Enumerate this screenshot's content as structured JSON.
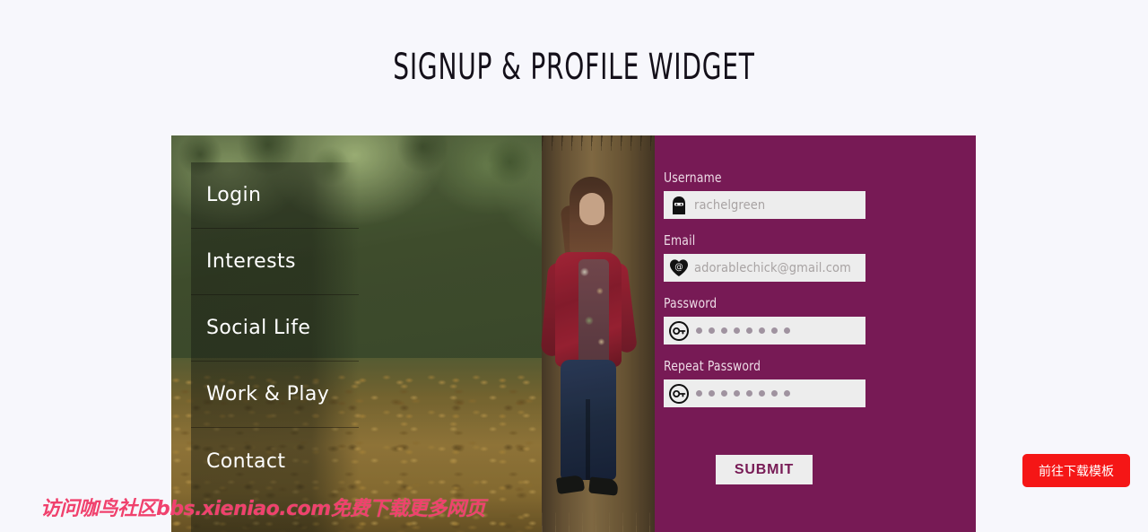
{
  "page": {
    "title": "SIGNUP & PROFILE WIDGET",
    "background_color": "#f7f7fc",
    "accent_color": "#771a55"
  },
  "menu": {
    "items": [
      {
        "label": "Login"
      },
      {
        "label": "Interests"
      },
      {
        "label": "Social Life"
      },
      {
        "label": "Work & Play"
      },
      {
        "label": "Contact"
      }
    ]
  },
  "form": {
    "fields": [
      {
        "label": "Username",
        "icon": "ninja-person-icon",
        "value": "rachelgreen",
        "placeholder": "rachelgreen",
        "type": "text"
      },
      {
        "label": "Email",
        "icon": "heart-at-icon",
        "value": "adorablechick@gmail.com",
        "placeholder": "adorablechick@gmail.com",
        "type": "email"
      },
      {
        "label": "Password",
        "icon": "key-circle-icon",
        "value": "••••••••",
        "placeholder": "",
        "type": "password",
        "dot_count": 8
      },
      {
        "label": "Repeat Password",
        "icon": "key-circle-icon",
        "value": "••••••••",
        "placeholder": "",
        "type": "password",
        "dot_count": 8
      }
    ],
    "submit_label": "SUBMIT"
  },
  "watermark": {
    "text": "访问咖鸟社区bbs.xieniao.com免费下载更多网页",
    "color": "#f0416d"
  },
  "download_button": {
    "label": "前往下载模板",
    "color": "#f51616"
  }
}
